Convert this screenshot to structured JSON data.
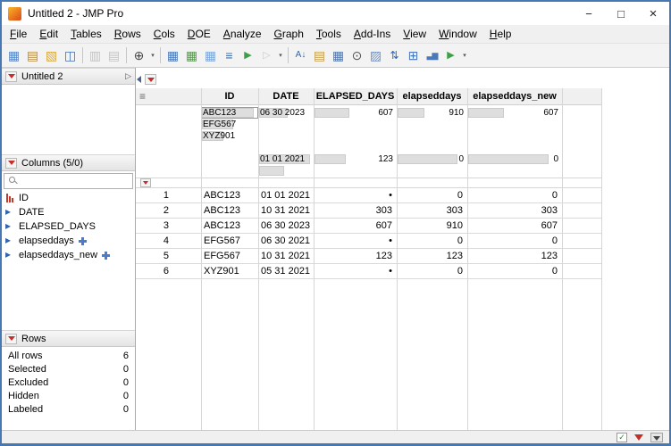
{
  "window": {
    "title": "Untitled 2 - JMP Pro",
    "controls": {
      "minimize": "−",
      "maximize": "□",
      "close": "×"
    }
  },
  "menu": {
    "items": [
      "File",
      "Edit",
      "Tables",
      "Rows",
      "Cols",
      "DOE",
      "Analyze",
      "Graph",
      "Tools",
      "Add-Ins",
      "View",
      "Window",
      "Help"
    ]
  },
  "toolbar": {
    "items": [
      {
        "type": "icon",
        "name": "new-data-table-icon",
        "glyph": "▦",
        "interactable": "true"
      },
      {
        "type": "icon",
        "name": "new-journal-icon",
        "glyph": "▤",
        "interactable": "true"
      },
      {
        "type": "icon",
        "name": "open-icon",
        "glyph": "▧",
        "interactable": "true"
      },
      {
        "type": "icon",
        "name": "save-icon",
        "glyph": "◫",
        "interactable": "true"
      },
      {
        "type": "sep",
        "interactable": "false"
      },
      {
        "type": "icon",
        "name": "copy-icon",
        "glyph": "▥",
        "state": "disabled",
        "interactable": "true"
      },
      {
        "type": "icon",
        "name": "paste-icon",
        "glyph": "▤",
        "state": "disabled",
        "interactable": "true"
      },
      {
        "type": "sep",
        "interactable": "false"
      },
      {
        "type": "icon",
        "name": "zoom-icon",
        "glyph": "⊕",
        "interactable": "true"
      },
      {
        "type": "dropdown",
        "name": "zoom-dropdown-icon",
        "glyph": "▾",
        "interactable": "true"
      },
      {
        "type": "sep",
        "interactable": "false"
      },
      {
        "type": "icon",
        "name": "summary-icon",
        "glyph": "▦",
        "interactable": "true"
      },
      {
        "type": "icon",
        "name": "subset-icon",
        "glyph": "▦",
        "interactable": "true"
      },
      {
        "type": "icon",
        "name": "transpose-icon",
        "glyph": "▦",
        "interactable": "true"
      },
      {
        "type": "icon",
        "name": "sort-table-icon",
        "glyph": "≡",
        "interactable": "true"
      },
      {
        "type": "icon",
        "name": "run-script-icon",
        "glyph": "▶",
        "interactable": "true"
      },
      {
        "type": "icon",
        "name": "script-window-icon",
        "glyph": "▷",
        "state": "disabled",
        "interactable": "true"
      },
      {
        "type": "overflow",
        "name": "toolbar-overflow-icon",
        "glyph": "▾",
        "interactable": "true"
      },
      {
        "type": "sep",
        "interactable": "false"
      },
      {
        "type": "icon",
        "name": "sort-az-icon",
        "glyph": "A↓",
        "interactable": "true"
      },
      {
        "type": "icon",
        "name": "column-info-icon",
        "glyph": "▤",
        "interactable": "true"
      },
      {
        "type": "icon",
        "name": "tabulate-icon",
        "glyph": "▦",
        "interactable": "true"
      },
      {
        "type": "icon",
        "name": "search-data-icon",
        "glyph": "⊙",
        "interactable": "true"
      },
      {
        "type": "icon",
        "name": "recode-icon",
        "glyph": "▨",
        "interactable": "true"
      },
      {
        "type": "icon",
        "name": "sort-columns-icon",
        "glyph": "⇅",
        "interactable": "true"
      },
      {
        "type": "icon",
        "name": "join-tables-icon",
        "glyph": "⊞",
        "interactable": "true"
      },
      {
        "type": "icon",
        "name": "chart-icon",
        "glyph": "▃▆",
        "interactable": "true"
      },
      {
        "type": "icon",
        "name": "run-analysis-icon",
        "glyph": "▶",
        "interactable": "true"
      },
      {
        "type": "overflow",
        "name": "toolbar-overflow-icon-2",
        "glyph": "▾",
        "interactable": "true"
      }
    ]
  },
  "sidebar": {
    "table_panel": {
      "title": "Untitled 2"
    },
    "columns_panel": {
      "title": "Columns (5/0)",
      "search_value": "",
      "items": [
        {
          "label": "ID",
          "icon": "nominal-icon"
        },
        {
          "label": "DATE",
          "icon": "continuous-icon"
        },
        {
          "label": "ELAPSED_DAYS",
          "icon": "continuous-icon"
        },
        {
          "label": "elapseddays",
          "icon": "continuous-icon",
          "formula": "true"
        },
        {
          "label": "elapseddays_new",
          "icon": "continuous-icon",
          "formula": "true"
        }
      ]
    },
    "rows_panel": {
      "title": "Rows",
      "stats": [
        {
          "label": "All rows",
          "value": "6"
        },
        {
          "label": "Selected",
          "value": "0"
        },
        {
          "label": "Excluded",
          "value": "0"
        },
        {
          "label": "Hidden",
          "value": "0"
        },
        {
          "label": "Labeled",
          "value": "0"
        }
      ]
    }
  },
  "grid": {
    "columns": [
      "ID",
      "DATE",
      "ELAPSED_DAYS",
      "elapseddays",
      "elapseddays_new"
    ],
    "header_graphs": [
      {
        "column": "ID",
        "align": "left",
        "slots": [
          {
            "label": "ABC123",
            "bar": 90,
            "boxed": "true"
          },
          {
            "label": "EFG567",
            "bar": 55
          },
          {
            "label": "XYZ901",
            "bar": 38
          },
          {},
          {},
          {}
        ]
      },
      {
        "column": "DATE",
        "align": "left",
        "slots": [
          {
            "label": "06 30 2023",
            "bar": 52
          },
          {},
          {},
          {},
          {
            "label": "01 01 2021",
            "bar": 92
          },
          {
            "bar": 45
          }
        ]
      },
      {
        "column": "ELAPSED_DAYS",
        "align": "right",
        "slots": [
          {
            "label": "607",
            "bar": 42
          },
          {},
          {},
          {},
          {
            "label": "123",
            "bar": 38
          },
          {}
        ]
      },
      {
        "column": "elapseddays",
        "align": "right",
        "slots": [
          {
            "label": "910",
            "bar": 38
          },
          {},
          {},
          {},
          {
            "label": "0",
            "bar": 85
          },
          {}
        ]
      },
      {
        "column": "elapseddays_new",
        "align": "right",
        "slots": [
          {
            "label": "607",
            "bar": 38
          },
          {},
          {},
          {},
          {
            "label": "0",
            "bar": 85
          },
          {}
        ]
      }
    ],
    "rows": [
      {
        "n": "1",
        "cells": [
          "ABC123",
          "01 01 2021",
          "•",
          "0",
          "0"
        ]
      },
      {
        "n": "2",
        "cells": [
          "ABC123",
          "10 31 2021",
          "303",
          "303",
          "303"
        ]
      },
      {
        "n": "3",
        "cells": [
          "ABC123",
          "06 30 2023",
          "607",
          "910",
          "607"
        ]
      },
      {
        "n": "4",
        "cells": [
          "EFG567",
          "06 30 2021",
          "•",
          "0",
          "0"
        ]
      },
      {
        "n": "5",
        "cells": [
          "EFG567",
          "10 31 2021",
          "123",
          "123",
          "123"
        ]
      },
      {
        "n": "6",
        "cells": [
          "XYZ901",
          "05 31 2021",
          "•",
          "0",
          "0"
        ]
      }
    ]
  },
  "statusbar": {
    "icons": [
      {
        "name": "table-ok-icon"
      },
      {
        "name": "status-red-triangle-icon"
      },
      {
        "name": "panel-toggle-icon"
      }
    ]
  }
}
